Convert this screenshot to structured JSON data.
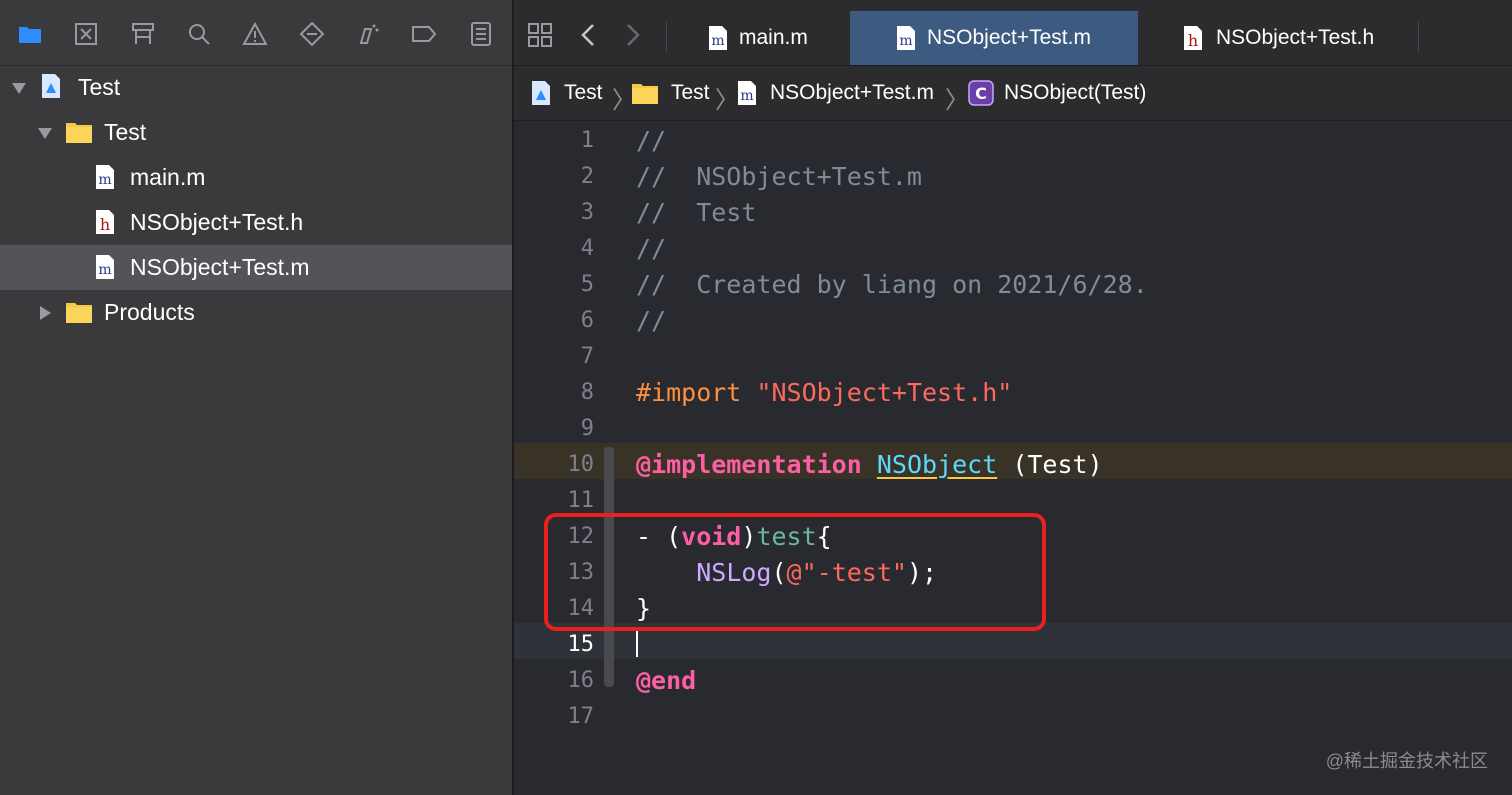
{
  "navigator": {
    "toolbar_icons": [
      "folder-icon",
      "source-control-icon",
      "symbol-icon",
      "search-icon",
      "warning-icon",
      "test-icon",
      "debug-icon",
      "breakpoint-icon",
      "report-icon"
    ],
    "tree": [
      {
        "label": "Test",
        "type": "project"
      },
      {
        "label": "Test",
        "type": "folder"
      },
      {
        "label": "main.m",
        "type": "m"
      },
      {
        "label": "NSObject+Test.h",
        "type": "h"
      },
      {
        "label": "NSObject+Test.m",
        "type": "m"
      },
      {
        "label": "Products",
        "type": "folder"
      }
    ]
  },
  "tabs": [
    {
      "label": "main.m",
      "icon": "m-file-icon"
    },
    {
      "label": "NSObject+Test.m",
      "icon": "m-file-icon",
      "active": true
    },
    {
      "label": "NSObject+Test.h",
      "icon": "h-file-icon"
    }
  ],
  "breadcrumbs": [
    "Test",
    "Test",
    "NSObject+Test.m",
    "NSObject(Test)"
  ],
  "code": {
    "line_numbers": [
      "1",
      "2",
      "3",
      "4",
      "5",
      "6",
      "7",
      "8",
      "9",
      "10",
      "11",
      "12",
      "13",
      "14",
      "15",
      "16",
      "17"
    ],
    "comment_slashes": "//",
    "comment_filename": "//  NSObject+Test.m",
    "comment_project": "//  Test",
    "comment_created": "//  Created by liang on 2021/6/28.",
    "import_directive": "#import",
    "import_file": "\"NSObject+Test.h\"",
    "at_implementation": "@implementation",
    "class_name": "NSObject",
    "category": " (Test)",
    "method_dash": "- (",
    "void_kw": "void",
    "method_close_paren": ")",
    "method_name": "test",
    "open_brace": "{",
    "nslog": "NSLog",
    "nslog_open": "(",
    "string_literal": "@\"-test\"",
    "nslog_close": ");",
    "close_brace": "}",
    "at_end": "@end"
  },
  "watermark": "@稀土掘金技术社区",
  "colors": {
    "highlight_box": "#e8211f",
    "active_tab": "#3d5a80"
  }
}
